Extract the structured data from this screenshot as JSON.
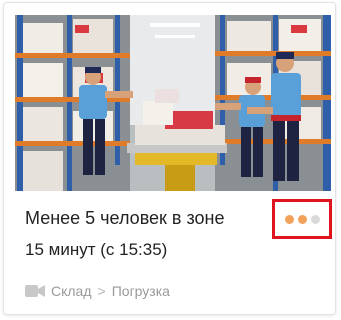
{
  "card": {
    "title": "Менее 5 человек в зоне",
    "duration": "15 минут",
    "since": "(с 15:35)",
    "severity": {
      "level": 2,
      "max": 3,
      "active_color": "#f2a25a",
      "inactive_color": "#d9d9d9",
      "highlight_color": "#e0141e"
    },
    "location": {
      "icon": "video-camera-icon",
      "site": "Склад",
      "separator": ">",
      "zone": "Погрузка"
    }
  }
}
